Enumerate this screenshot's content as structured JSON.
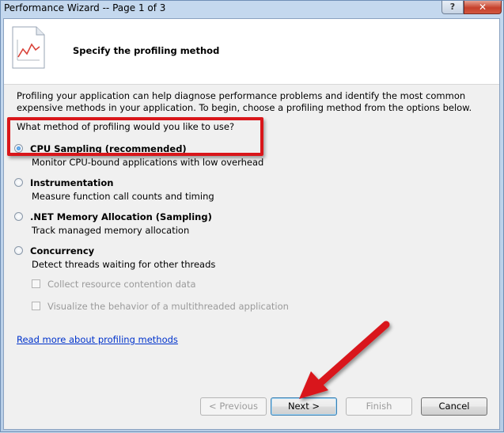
{
  "window": {
    "title": "Performance Wizard -- Page 1 of 3",
    "help_label": "?",
    "close_label": "✕"
  },
  "header": {
    "heading": "Specify the profiling method"
  },
  "body": {
    "description": "Profiling your application can help diagnose performance problems and identify the most common expensive methods in your application. To begin, choose a profiling method from the options below.",
    "question": "What method of profiling would you like to use?",
    "options": [
      {
        "title": "CPU Sampling (recommended)",
        "desc": "Monitor CPU-bound applications with low overhead",
        "selected": true
      },
      {
        "title": "Instrumentation",
        "desc": "Measure function call counts and timing",
        "selected": false
      },
      {
        "title": ".NET Memory Allocation (Sampling)",
        "desc": "Track managed memory allocation",
        "selected": false
      },
      {
        "title": "Concurrency",
        "desc": "Detect threads waiting for other threads",
        "selected": false
      }
    ],
    "checkboxes": [
      {
        "label": "Collect resource contention data",
        "checked": false,
        "enabled": false
      },
      {
        "label": "Visualize the behavior of a multithreaded application",
        "checked": false,
        "enabled": false
      }
    ],
    "link": "Read more about profiling methods"
  },
  "footer": {
    "previous": "< Previous",
    "next": "Next >",
    "finish": "Finish",
    "cancel": "Cancel"
  },
  "colors": {
    "highlight": "#d9161a",
    "link": "#0033cc"
  }
}
